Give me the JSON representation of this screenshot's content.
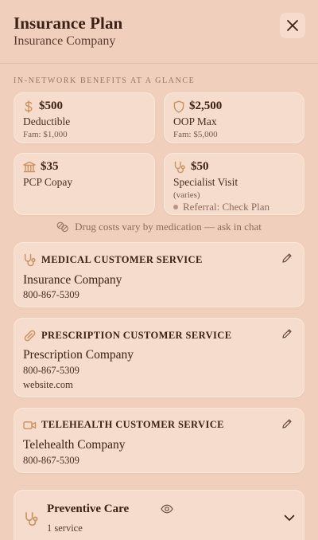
{
  "header": {
    "title": "Insurance Plan",
    "subtitle": "Insurance Company"
  },
  "section_label": "In-Network Benefits at a Glance",
  "benefits": [
    {
      "icon": "dollar-icon",
      "amount": "$500",
      "label": "Deductible",
      "sub": "Fam: $1,000"
    },
    {
      "icon": "shield-icon",
      "amount": "$2,500",
      "label": "OOP Max",
      "sub": "Fam: $5,000"
    },
    {
      "icon": "hospital-icon",
      "amount": "$35",
      "label": "PCP Copay"
    },
    {
      "icon": "stethoscope-icon",
      "amount": "$50",
      "label": "Specialist Visit",
      "sub": "(varies)",
      "note": "Referral: Check Plan"
    }
  ],
  "drug_note": "Drug costs vary by medication — ask in chat",
  "services": [
    {
      "icon": "stethoscope-icon",
      "title": "MEDICAL CUSTOMER SERVICE",
      "company": "Insurance Company",
      "phone": "800-867-5309"
    },
    {
      "icon": "pill-icon",
      "title": "PRESCRIPTION CUSTOMER SERVICE",
      "company": "Prescription Company",
      "phone": "800-867-5309",
      "website": "website.com"
    },
    {
      "icon": "video-icon",
      "title": "TELEHEALTH CUSTOMER SERVICE",
      "company": "Telehealth Company",
      "phone": "800-867-5309"
    }
  ],
  "preventive": {
    "title": "Preventive Care",
    "count": "1 service"
  },
  "colors": {
    "background": "#f0d0bd",
    "card": "#f7decf",
    "accent": "#c9925f",
    "text": "#3c2014"
  }
}
